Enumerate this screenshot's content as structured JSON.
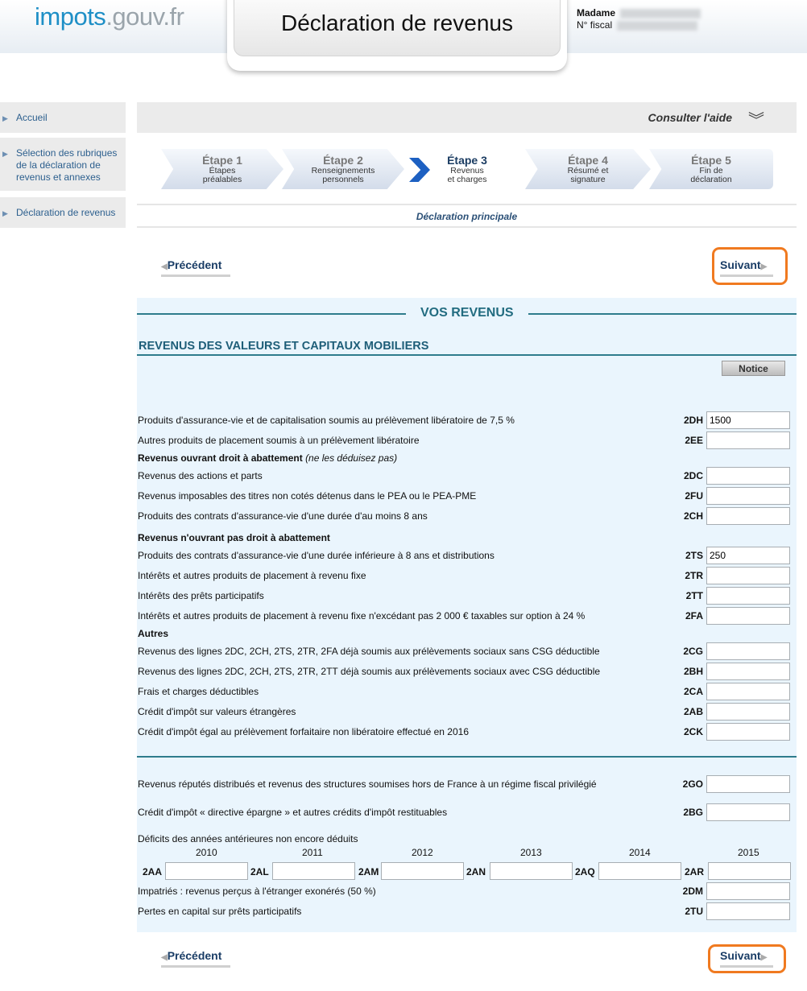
{
  "header": {
    "logo_part1": "impots",
    "logo_part2": ".gouv.fr",
    "title": "Déclaration de revenus",
    "user_label": "Madame",
    "fiscal_label": "N° fiscal"
  },
  "sidebar": {
    "items": [
      {
        "label": "Accueil"
      },
      {
        "label": "Sélection des rubriques de la déclaration de revenus et annexes"
      },
      {
        "label": "Déclaration de revenus"
      }
    ]
  },
  "help": {
    "label": "Consulter l'aide"
  },
  "steps": [
    {
      "num": "Étape 1",
      "desc1": "Étapes",
      "desc2": "préalables"
    },
    {
      "num": "Étape 2",
      "desc1": "Renseignements",
      "desc2": "personnels"
    },
    {
      "num": "Étape 3",
      "desc1": "Revenus",
      "desc2": "et charges"
    },
    {
      "num": "Étape 4",
      "desc1": "Résumé et",
      "desc2": "signature"
    },
    {
      "num": "Étape 5",
      "desc1": "Fin de",
      "desc2": "déclaration"
    }
  ],
  "decl_title": "Déclaration principale",
  "nav": {
    "prev": "Précédent",
    "next": "Suivant"
  },
  "form": {
    "vos_revenus": "VOS REVENUS",
    "section_title": "REVENUS DES VALEURS ET CAPITAUX MOBILIERS",
    "notice": "Notice",
    "rows": [
      {
        "label": "Produits d'assurance-vie et de capitalisation soumis au prélèvement libératoire de 7,5 %",
        "code": "2DH",
        "value": "1500"
      },
      {
        "label": "Autres produits de placement soumis à un prélèvement libératoire",
        "code": "2EE",
        "value": ""
      },
      {
        "label": "Revenus des actions et parts",
        "code": "2DC",
        "value": ""
      },
      {
        "label": "Revenus imposables des titres non cotés détenus dans le PEA ou le PEA-PME",
        "code": "2FU",
        "value": ""
      },
      {
        "label": "Produits des contrats d'assurance-vie d'une durée d'au moins 8 ans",
        "code": "2CH",
        "value": ""
      },
      {
        "label": "Produits des contrats d'assurance-vie d'une durée inférieure à 8 ans et distributions",
        "code": "2TS",
        "value": "250"
      },
      {
        "label": "Intérêts et autres produits de placement à revenu fixe",
        "code": "2TR",
        "value": ""
      },
      {
        "label": "Intérêts des prêts participatifs",
        "code": "2TT",
        "value": ""
      },
      {
        "label": "Intérêts et autres produits de placement à revenu fixe n'excédant pas 2 000 € taxables sur option à 24 %",
        "code": "2FA",
        "value": ""
      },
      {
        "label": "Revenus des lignes 2DC, 2CH, 2TS, 2TR, 2FA déjà soumis aux prélèvements sociaux sans CSG déductible",
        "code": "2CG",
        "value": ""
      },
      {
        "label": "Revenus des lignes 2DC, 2CH, 2TS, 2TR, 2TT déjà soumis aux prélèvements sociaux avec CSG déductible",
        "code": "2BH",
        "value": ""
      },
      {
        "label": "Frais et charges déductibles",
        "code": "2CA",
        "value": ""
      },
      {
        "label": "Crédit d'impôt sur valeurs étrangères",
        "code": "2AB",
        "value": ""
      },
      {
        "label": "Crédit d'impôt égal au prélèvement forfaitaire non libératoire effectué en 2016",
        "code": "2CK",
        "value": ""
      },
      {
        "label": "Revenus réputés distribués et revenus des structures soumises hors de France à un régime fiscal privilégié",
        "code": "2GO",
        "value": ""
      },
      {
        "label": "Crédit d'impôt « directive épargne » et autres crédits d'impôt restituables",
        "code": "2BG",
        "value": ""
      },
      {
        "label": "Impatriés : revenus perçus à l'étranger exonérés (50 %)",
        "code": "2DM",
        "value": ""
      },
      {
        "label": "Pertes en capital sur prêts participatifs",
        "code": "2TU",
        "value": ""
      }
    ],
    "subheads": {
      "abattement": "Revenus ouvrant droit à abattement",
      "abattement_note": "(ne les déduisez pas)",
      "no_abattement": "Revenus n'ouvrant pas droit à abattement",
      "autres": "Autres"
    },
    "deficits": {
      "label": "Déficits des années antérieures non encore déduits",
      "years": [
        "2010",
        "2011",
        "2012",
        "2013",
        "2014",
        "2015"
      ],
      "codes": [
        "2AA",
        "2AL",
        "2AM",
        "2AN",
        "2AQ",
        "2AR"
      ]
    }
  },
  "colors": {
    "accent": "#f07a20",
    "link": "#1a3d66",
    "section": "#2e7c8c",
    "form_bg": "#eaf5fd"
  }
}
